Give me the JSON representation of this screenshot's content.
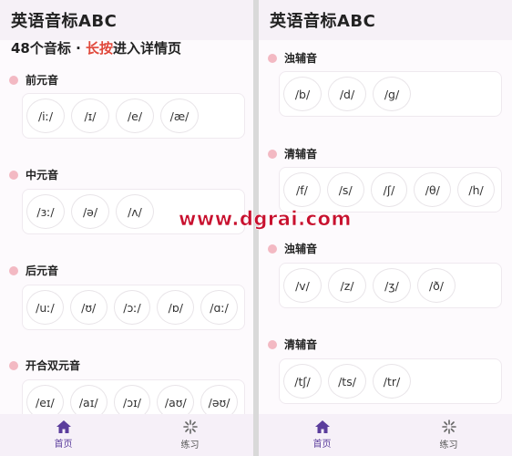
{
  "left": {
    "title": "英语音标ABC",
    "subtitle_prefix": "48个音标 · ",
    "subtitle_highlight": "长按",
    "subtitle_suffix": "进入详情页",
    "sections": [
      {
        "label": "前元音",
        "chips": [
          "/iː/",
          "/ɪ/",
          "/e/",
          "/æ/"
        ]
      },
      {
        "label": "中元音",
        "chips": [
          "/ɜː/",
          "/ə/",
          "/ʌ/"
        ]
      },
      {
        "label": "后元音",
        "chips": [
          "/uː/",
          "/ʊ/",
          "/ɔː/",
          "/ɒ/",
          "/ɑː/"
        ]
      },
      {
        "label": "开合双元音",
        "chips": [
          "/eɪ/",
          "/aɪ/",
          "/ɔɪ/",
          "/aʊ/",
          "/əʊ/"
        ]
      }
    ]
  },
  "right": {
    "title": "英语音标ABC",
    "sections": [
      {
        "label": "浊辅音",
        "chips": [
          "/b/",
          "/d/",
          "/g/"
        ]
      },
      {
        "label": "清辅音",
        "chips": [
          "/f/",
          "/s/",
          "/ʃ/",
          "/θ/",
          "/h/"
        ]
      },
      {
        "label": "浊辅音",
        "chips": [
          "/v/",
          "/z/",
          "/ʒ/",
          "/ð/"
        ]
      },
      {
        "label": "清辅音",
        "chips": [
          "/tʃ/",
          "/ts/",
          "/tr/"
        ]
      }
    ]
  },
  "nav": {
    "home": "首页",
    "practice": "练习"
  },
  "watermark": "www.dgrai.com",
  "colors": {
    "accent": "#5b3d9c",
    "highlight": "#e0473a",
    "dot": "#f3b9c3"
  }
}
